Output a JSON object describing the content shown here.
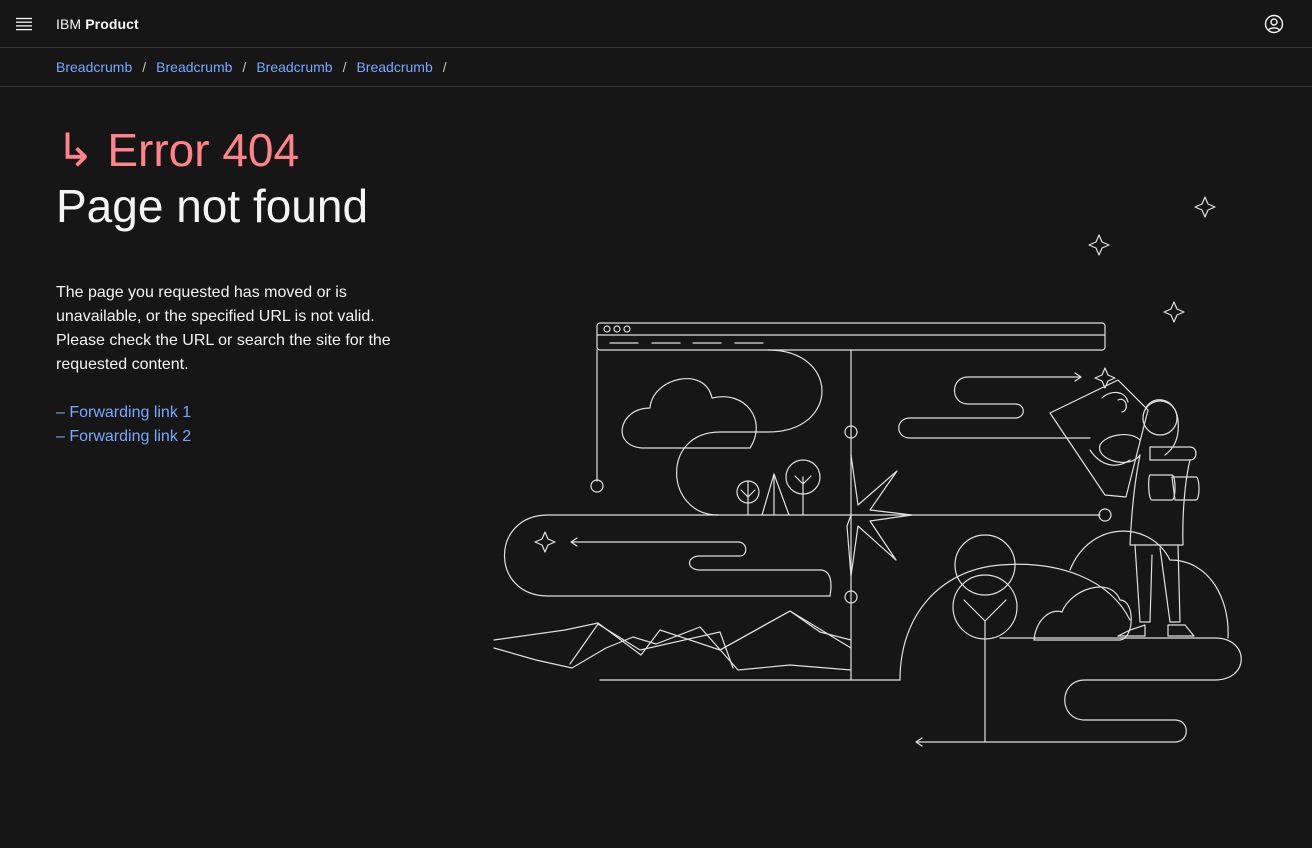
{
  "header": {
    "brand_prefix": "IBM",
    "brand_name": "Product",
    "menu_icon": "hamburger-menu-icon",
    "user_icon": "user-avatar-icon"
  },
  "breadcrumb": {
    "items": [
      {
        "label": "Breadcrumb"
      },
      {
        "label": "Breadcrumb"
      },
      {
        "label": "Breadcrumb"
      },
      {
        "label": "Breadcrumb"
      }
    ],
    "separator": "/"
  },
  "error": {
    "code_arrow": "↳",
    "code_text": "Error 404",
    "title": "Page not found",
    "description": "The page you requested has moved or is unavailable, or the specified URL is not valid. Please check the URL or search the site for the requested content.",
    "links": [
      {
        "label": "– Forwarding link 1"
      },
      {
        "label": "– Forwarding link 2"
      }
    ]
  },
  "colors": {
    "background": "#161616",
    "error_accent": "#ff8389",
    "link": "#78a9ff",
    "text": "#f4f4f4",
    "border": "#393939"
  }
}
